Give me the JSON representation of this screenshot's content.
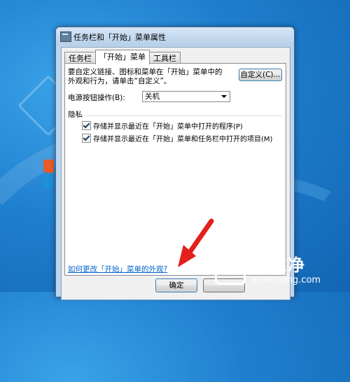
{
  "window": {
    "title": "任务栏和「开始」菜单属性"
  },
  "tabs": [
    {
      "label": "任务栏"
    },
    {
      "label": "「开始」菜单"
    },
    {
      "label": "工具栏"
    }
  ],
  "start_menu": {
    "description": "要自定义链接、图标和菜单在「开始」菜单中的外观和行为，请单击“自定义”。",
    "customize_button": "自定义(C)...",
    "power_label": "电源按钮操作(B):",
    "power_value": "关机",
    "privacy_label": "隐私",
    "privacy_options": [
      {
        "label": "存储并显示最近在「开始」菜单中打开的程序(P)",
        "checked": true
      },
      {
        "label": "存储并显示最近在「开始」菜单和任务栏中打开的项目(M)",
        "checked": true
      }
    ],
    "appearance_link": "如何更改「开始」菜单的外观?"
  },
  "footer": {
    "ok_button": "确定",
    "cancel_button": ""
  },
  "watermark": {
    "brand_cn": "爱纯净",
    "brand_url": "aichunjing.com"
  },
  "colors": {
    "desktop": "#1f7fcf",
    "arrow": "#e3201b",
    "link": "#0066cc"
  }
}
